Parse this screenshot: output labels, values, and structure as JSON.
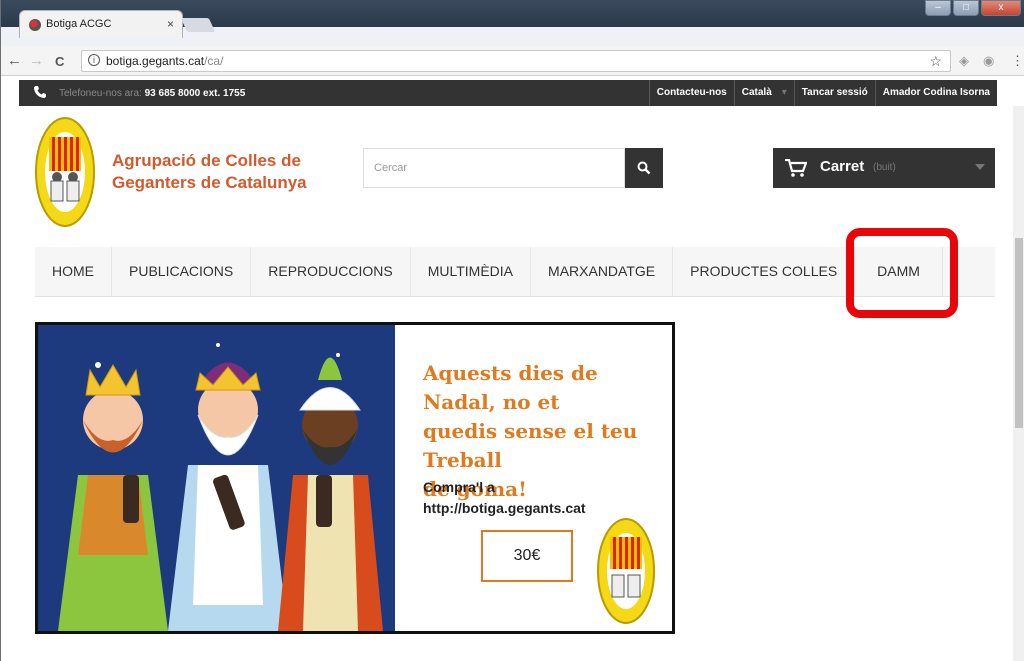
{
  "browser": {
    "tab_title": "Botiga ACGC",
    "tab_close": "×",
    "url_host": "botiga.gegants.cat",
    "url_path": "/ca/",
    "info_glyph": "i",
    "star_glyph": "☆",
    "back_glyph": "←",
    "forward_glyph": "→",
    "reload_glyph": "C",
    "menu_glyph": "⋮",
    "win_min": "–",
    "win_max": "□",
    "win_close": "x"
  },
  "topbar": {
    "phone_prefix": "Telefoneu-nos ara:",
    "phone_number": "93 685 8000 ext. 1755",
    "links": [
      "Contacteu-nos",
      "Català",
      "Tancar sessió",
      "Amador Codina Isorna"
    ],
    "caret": "▾"
  },
  "header": {
    "brand_line1": "Agrupació de Colles de",
    "brand_line2": "Geganters de Catalunya",
    "search_placeholder": "Cercar",
    "cart_label": "Carret",
    "cart_status": "(buit)"
  },
  "nav": {
    "items": [
      "HOME",
      "PUBLICACIONS",
      "REPRODUCCIONS",
      "MULTIMÈDIA",
      "MARXANDATGE",
      "PRODUCTES COLLES",
      "DAMM"
    ]
  },
  "banner": {
    "headline_line1": "Aquests dies de Nadal, no et",
    "headline_line2": "quedis sense el teu Treball",
    "headline_line3": "de goma!",
    "buy_line1": "Compra'l a",
    "buy_line2": "http://botiga.gegants.cat",
    "price": "30€"
  },
  "colors": {
    "brand_orange": "#d35a2b",
    "highlight_red": "#e8060a",
    "dark_bar": "#333333",
    "banner_orange": "#e07a1e"
  }
}
